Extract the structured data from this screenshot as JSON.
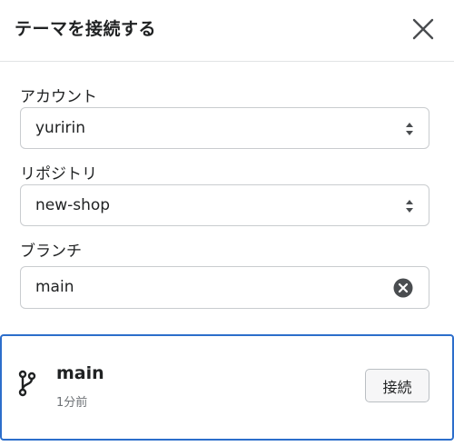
{
  "dialog": {
    "title": "テーマを接続する"
  },
  "form": {
    "account": {
      "label": "アカウント",
      "value": "yuririn"
    },
    "repository": {
      "label": "リポジトリ",
      "value": "new-shop"
    },
    "branch": {
      "label": "ブランチ",
      "value": "main"
    }
  },
  "result": {
    "branch_name": "main",
    "updated": "1分前",
    "connect_label": "接続"
  },
  "colors": {
    "accent": "#2c6ecb",
    "text": "#202223",
    "subdued": "#6d7175",
    "border": "#c9cccf"
  },
  "icons": [
    "close-icon",
    "select-arrows-icon",
    "clear-icon",
    "git-branch-icon"
  ]
}
